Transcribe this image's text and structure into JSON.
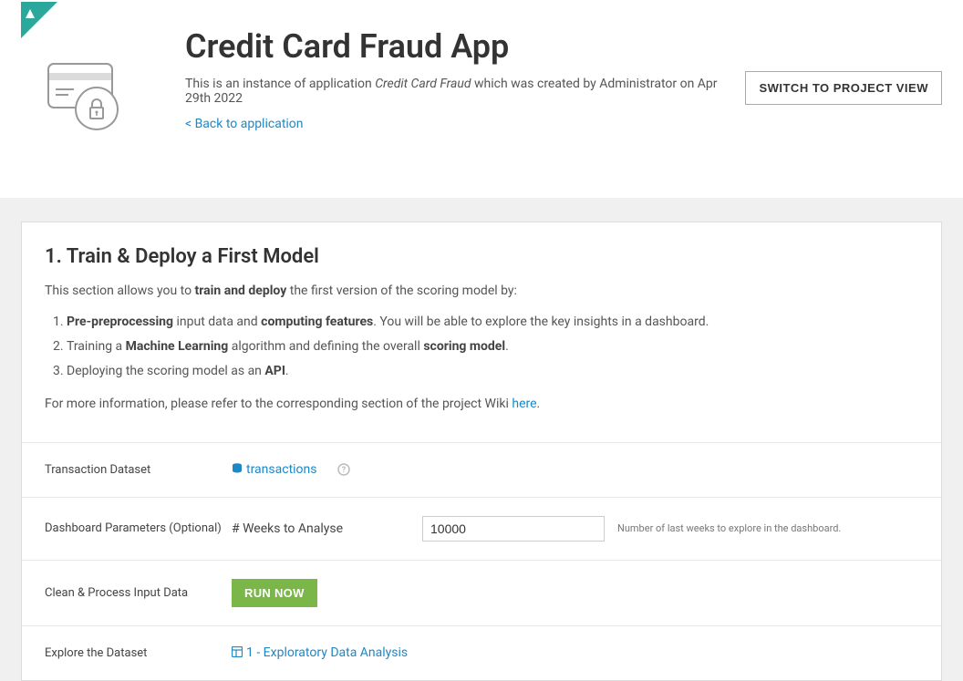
{
  "header": {
    "title": "Credit Card Fraud App",
    "subtitle_prefix": "This is an instance of application ",
    "subtitle_appname": "Credit Card Fraud",
    "subtitle_suffix": " which was created by Administrator on Apr 29th 2022",
    "back_link": "< Back to application",
    "switch_button": "SWITCH TO PROJECT VIEW"
  },
  "section1": {
    "title": "1. Train & Deploy a First Model",
    "intro_a": "This section allows you to ",
    "intro_b": "train and deploy",
    "intro_c": " the first version of the scoring model by:",
    "li1_a": "Pre-preprocessing",
    "li1_b": " input data and ",
    "li1_c": "computing features",
    "li1_d": ". You will be able to explore the key insights in a dashboard.",
    "li2_a": "Training a ",
    "li2_b": "Machine Learning",
    "li2_c": " algorithm and defining the overall ",
    "li2_d": "scoring model",
    "li2_e": ".",
    "li3_a": "Deploying the scoring model as an ",
    "li3_b": "API",
    "li3_c": ".",
    "more_a": "For more information, please refer to the corresponding section of the project Wiki ",
    "more_link": "here",
    "more_b": "."
  },
  "rows": {
    "dataset_label": "Transaction Dataset",
    "dataset_link": "transactions",
    "params_label": "Dashboard Parameters (Optional)",
    "weeks_label": "# Weeks to Analyse",
    "weeks_value": "10000",
    "weeks_hint": "Number of last weeks to explore in the dashboard.",
    "clean_label": "Clean & Process Input Data",
    "run_now": "RUN NOW",
    "explore_label": "Explore the Dataset",
    "explore_link": "1 - Exploratory Data Analysis"
  }
}
